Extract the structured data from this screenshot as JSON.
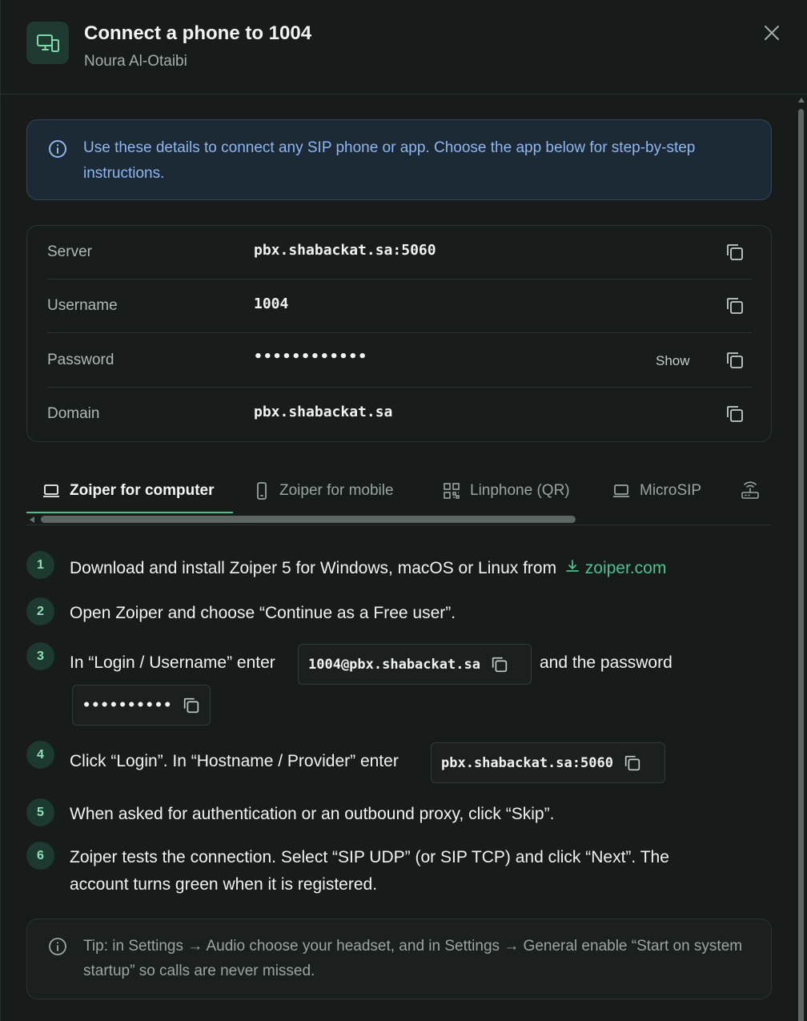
{
  "header": {
    "title": "Connect a phone to 1004",
    "subtitle": "Noura Al-Otaibi",
    "icon": "device-phone-icon",
    "close_icon": "close-icon"
  },
  "info": {
    "text": "Use these details to connect any SIP phone or app. Choose the app below for step-by-step instructions."
  },
  "credentials": [
    {
      "label": "Server",
      "value": "pbx.shabackat.sa:5060"
    },
    {
      "label": "Username",
      "value": "1004"
    },
    {
      "label": "Password",
      "value": "••••••••••••",
      "show_label": "Show"
    },
    {
      "label": "Domain",
      "value": "pbx.shabackat.sa"
    }
  ],
  "tabs": [
    {
      "label": "Zoiper for computer",
      "icon": "laptop-icon",
      "active": true
    },
    {
      "label": "Zoiper for mobile",
      "icon": "mobile-icon",
      "active": false
    },
    {
      "label": "Linphone (QR)",
      "icon": "qr-code-icon",
      "active": false
    },
    {
      "label": "MicroSIP",
      "icon": "laptop-icon",
      "active": false
    },
    {
      "label": "",
      "icon": "router-icon",
      "active": false
    }
  ],
  "steps": {
    "s1": {
      "num": "1",
      "text": "Download and install Zoiper 5 for Windows, macOS or Linux from",
      "link": "zoiper.com"
    },
    "s2": {
      "num": "2",
      "text": "Open Zoiper and choose “Continue as a Free user”."
    },
    "s3": {
      "num": "3",
      "text_before": "In “Login / Username” enter",
      "chip1": "1004@pbx.shabackat.sa",
      "text_after": "and the password",
      "chip2": "••••••••••"
    },
    "s4": {
      "num": "4",
      "text": "Click “Login”. In “Hostname / Provider” enter",
      "chip": "pbx.shabackat.sa:5060"
    },
    "s5": {
      "num": "5",
      "text": "When asked for authentication or an outbound proxy, click “Skip”."
    },
    "s6": {
      "num": "6",
      "line1": "Zoiper tests the connection. Select “SIP UDP” (or SIP TCP) and click “Next”. The",
      "line2": "account turns green when it is registered."
    }
  },
  "tip": {
    "text": "Tip: in Settings → Audio choose your headset, and in Settings → General enable “Start on system startup” so calls are never missed."
  },
  "colors": {
    "accent": "#4fc08f",
    "info_text": "#8fb6ee",
    "background": "#171b1a"
  }
}
